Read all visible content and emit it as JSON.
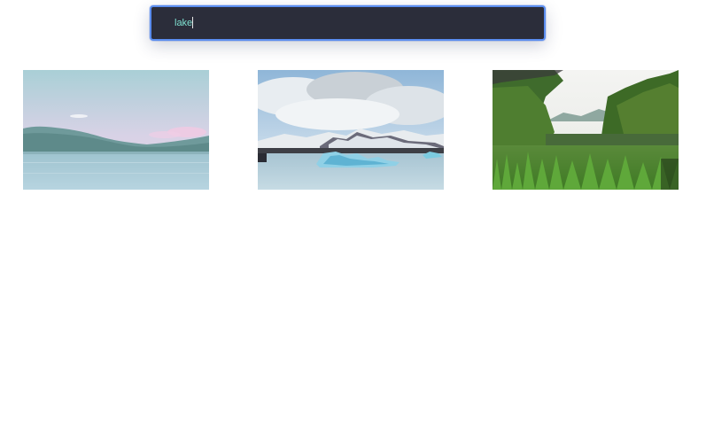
{
  "search": {
    "value": "lake"
  },
  "results": [
    {
      "icon": "lake-mountains-photo"
    },
    {
      "icon": "glacier-lagoon-icebergs-photo"
    },
    {
      "icon": "green-marsh-lake-photo"
    }
  ],
  "colors": {
    "search_bg": "#2b2d3a",
    "search_border": "#5b8def",
    "search_text": "#7fe0d0",
    "page_bg": "#ffffff"
  }
}
